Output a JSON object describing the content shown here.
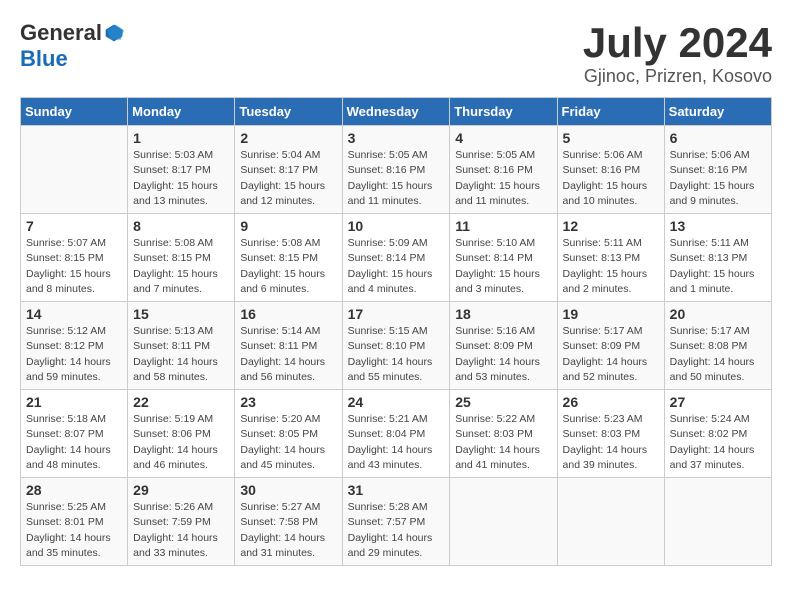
{
  "header": {
    "logo_general": "General",
    "logo_blue": "Blue",
    "title": "July 2024",
    "location": "Gjinoc, Prizren, Kosovo"
  },
  "calendar": {
    "days_of_week": [
      "Sunday",
      "Monday",
      "Tuesday",
      "Wednesday",
      "Thursday",
      "Friday",
      "Saturday"
    ],
    "weeks": [
      [
        {
          "day": "",
          "info": ""
        },
        {
          "day": "1",
          "info": "Sunrise: 5:03 AM\nSunset: 8:17 PM\nDaylight: 15 hours\nand 13 minutes."
        },
        {
          "day": "2",
          "info": "Sunrise: 5:04 AM\nSunset: 8:17 PM\nDaylight: 15 hours\nand 12 minutes."
        },
        {
          "day": "3",
          "info": "Sunrise: 5:05 AM\nSunset: 8:16 PM\nDaylight: 15 hours\nand 11 minutes."
        },
        {
          "day": "4",
          "info": "Sunrise: 5:05 AM\nSunset: 8:16 PM\nDaylight: 15 hours\nand 11 minutes."
        },
        {
          "day": "5",
          "info": "Sunrise: 5:06 AM\nSunset: 8:16 PM\nDaylight: 15 hours\nand 10 minutes."
        },
        {
          "day": "6",
          "info": "Sunrise: 5:06 AM\nSunset: 8:16 PM\nDaylight: 15 hours\nand 9 minutes."
        }
      ],
      [
        {
          "day": "7",
          "info": "Sunrise: 5:07 AM\nSunset: 8:15 PM\nDaylight: 15 hours\nand 8 minutes."
        },
        {
          "day": "8",
          "info": "Sunrise: 5:08 AM\nSunset: 8:15 PM\nDaylight: 15 hours\nand 7 minutes."
        },
        {
          "day": "9",
          "info": "Sunrise: 5:08 AM\nSunset: 8:15 PM\nDaylight: 15 hours\nand 6 minutes."
        },
        {
          "day": "10",
          "info": "Sunrise: 5:09 AM\nSunset: 8:14 PM\nDaylight: 15 hours\nand 4 minutes."
        },
        {
          "day": "11",
          "info": "Sunrise: 5:10 AM\nSunset: 8:14 PM\nDaylight: 15 hours\nand 3 minutes."
        },
        {
          "day": "12",
          "info": "Sunrise: 5:11 AM\nSunset: 8:13 PM\nDaylight: 15 hours\nand 2 minutes."
        },
        {
          "day": "13",
          "info": "Sunrise: 5:11 AM\nSunset: 8:13 PM\nDaylight: 15 hours\nand 1 minute."
        }
      ],
      [
        {
          "day": "14",
          "info": "Sunrise: 5:12 AM\nSunset: 8:12 PM\nDaylight: 14 hours\nand 59 minutes."
        },
        {
          "day": "15",
          "info": "Sunrise: 5:13 AM\nSunset: 8:11 PM\nDaylight: 14 hours\nand 58 minutes."
        },
        {
          "day": "16",
          "info": "Sunrise: 5:14 AM\nSunset: 8:11 PM\nDaylight: 14 hours\nand 56 minutes."
        },
        {
          "day": "17",
          "info": "Sunrise: 5:15 AM\nSunset: 8:10 PM\nDaylight: 14 hours\nand 55 minutes."
        },
        {
          "day": "18",
          "info": "Sunrise: 5:16 AM\nSunset: 8:09 PM\nDaylight: 14 hours\nand 53 minutes."
        },
        {
          "day": "19",
          "info": "Sunrise: 5:17 AM\nSunset: 8:09 PM\nDaylight: 14 hours\nand 52 minutes."
        },
        {
          "day": "20",
          "info": "Sunrise: 5:17 AM\nSunset: 8:08 PM\nDaylight: 14 hours\nand 50 minutes."
        }
      ],
      [
        {
          "day": "21",
          "info": "Sunrise: 5:18 AM\nSunset: 8:07 PM\nDaylight: 14 hours\nand 48 minutes."
        },
        {
          "day": "22",
          "info": "Sunrise: 5:19 AM\nSunset: 8:06 PM\nDaylight: 14 hours\nand 46 minutes."
        },
        {
          "day": "23",
          "info": "Sunrise: 5:20 AM\nSunset: 8:05 PM\nDaylight: 14 hours\nand 45 minutes."
        },
        {
          "day": "24",
          "info": "Sunrise: 5:21 AM\nSunset: 8:04 PM\nDaylight: 14 hours\nand 43 minutes."
        },
        {
          "day": "25",
          "info": "Sunrise: 5:22 AM\nSunset: 8:03 PM\nDaylight: 14 hours\nand 41 minutes."
        },
        {
          "day": "26",
          "info": "Sunrise: 5:23 AM\nSunset: 8:03 PM\nDaylight: 14 hours\nand 39 minutes."
        },
        {
          "day": "27",
          "info": "Sunrise: 5:24 AM\nSunset: 8:02 PM\nDaylight: 14 hours\nand 37 minutes."
        }
      ],
      [
        {
          "day": "28",
          "info": "Sunrise: 5:25 AM\nSunset: 8:01 PM\nDaylight: 14 hours\nand 35 minutes."
        },
        {
          "day": "29",
          "info": "Sunrise: 5:26 AM\nSunset: 7:59 PM\nDaylight: 14 hours\nand 33 minutes."
        },
        {
          "day": "30",
          "info": "Sunrise: 5:27 AM\nSunset: 7:58 PM\nDaylight: 14 hours\nand 31 minutes."
        },
        {
          "day": "31",
          "info": "Sunrise: 5:28 AM\nSunset: 7:57 PM\nDaylight: 14 hours\nand 29 minutes."
        },
        {
          "day": "",
          "info": ""
        },
        {
          "day": "",
          "info": ""
        },
        {
          "day": "",
          "info": ""
        }
      ]
    ]
  }
}
